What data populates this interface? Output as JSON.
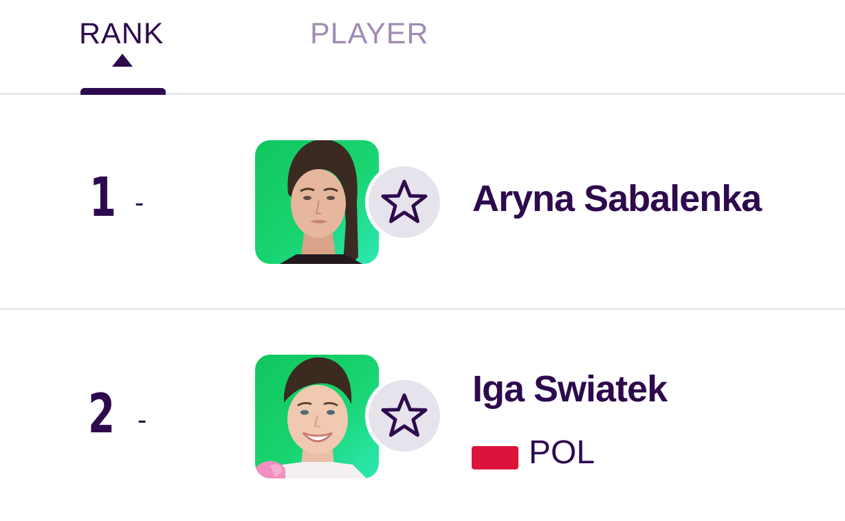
{
  "header": {
    "rank_label": "RANK",
    "player_label": "PLAYER",
    "sort_direction": "ascending"
  },
  "rows": [
    {
      "rank": "1",
      "movement": "-",
      "name": "Aryna Sabalenka",
      "favorite": false
    },
    {
      "rank": "2",
      "movement": "-",
      "name": "Iga Swiatek",
      "country_code": "POL",
      "favorite": false
    }
  ],
  "colors": {
    "primary": "#2d0a4e",
    "inactive_header": "#a08bb3",
    "divider": "#e9e7ee",
    "avatar_bg": "#18d470",
    "fav_bg": "#e7e3ec",
    "flag_red": "#dc143c"
  },
  "icons": {
    "favorite": "star-outline-icon",
    "sort": "triangle-up-icon"
  }
}
